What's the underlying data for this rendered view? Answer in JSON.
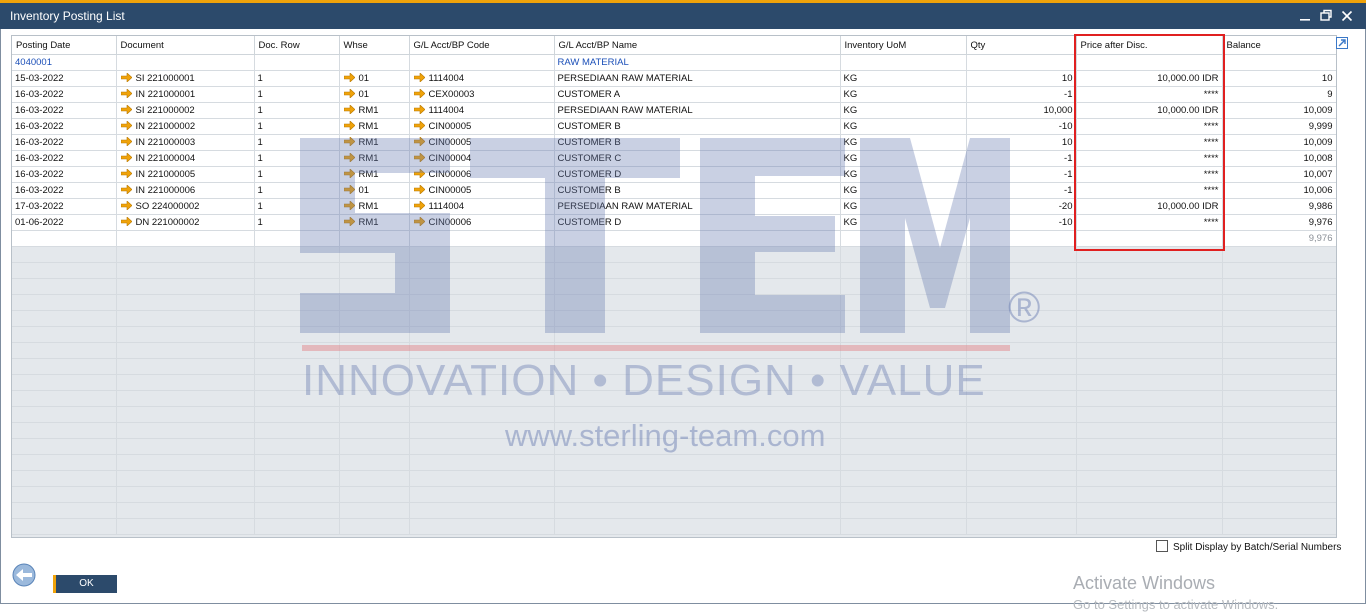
{
  "window": {
    "title": "Inventory Posting List"
  },
  "columns": [
    "Posting Date",
    "Document",
    "Doc. Row",
    "Whse",
    "G/L Acct/BP Code",
    "G/L Acct/BP Name",
    "Inventory UoM",
    "Qty",
    "Price after Disc.",
    "Balance"
  ],
  "group": {
    "code": "4040001",
    "name": "RAW MATERIAL"
  },
  "rows": [
    {
      "date": "15-03-2022",
      "document": "SI 221000001",
      "row": "1",
      "whse": "01",
      "code": "1114004",
      "name": "PERSEDIAAN RAW MATERIAL",
      "uom": "KG",
      "qty": "10",
      "price": "10,000.00 IDR",
      "balance": "10"
    },
    {
      "date": "16-03-2022",
      "document": "IN 221000001",
      "row": "1",
      "whse": "01",
      "code": "CEX00003",
      "name": "CUSTOMER A",
      "uom": "KG",
      "qty": "-1",
      "price": "****",
      "balance": "9"
    },
    {
      "date": "16-03-2022",
      "document": "SI 221000002",
      "row": "1",
      "whse": "RM1",
      "code": "1114004",
      "name": "PERSEDIAAN RAW MATERIAL",
      "uom": "KG",
      "qty": "10,000",
      "price": "10,000.00 IDR",
      "balance": "10,009"
    },
    {
      "date": "16-03-2022",
      "document": "IN 221000002",
      "row": "1",
      "whse": "RM1",
      "code": "CIN00005",
      "name": "CUSTOMER B",
      "uom": "KG",
      "qty": "-10",
      "price": "****",
      "balance": "9,999"
    },
    {
      "date": "16-03-2022",
      "document": "IN 221000003",
      "row": "1",
      "whse": "RM1",
      "code": "CIN00005",
      "name": "CUSTOMER B",
      "uom": "KG",
      "qty": "10",
      "price": "****",
      "balance": "10,009"
    },
    {
      "date": "16-03-2022",
      "document": "IN 221000004",
      "row": "1",
      "whse": "RM1",
      "code": "CIN00004",
      "name": "CUSTOMER C",
      "uom": "KG",
      "qty": "-1",
      "price": "****",
      "balance": "10,008"
    },
    {
      "date": "16-03-2022",
      "document": "IN 221000005",
      "row": "1",
      "whse": "RM1",
      "code": "CIN00006",
      "name": "CUSTOMER D",
      "uom": "KG",
      "qty": "-1",
      "price": "****",
      "balance": "10,007"
    },
    {
      "date": "16-03-2022",
      "document": "IN 221000006",
      "row": "1",
      "whse": "01",
      "code": "CIN00005",
      "name": "CUSTOMER B",
      "uom": "KG",
      "qty": "-1",
      "price": "****",
      "balance": "10,006"
    },
    {
      "date": "17-03-2022",
      "document": "SO 224000002",
      "row": "1",
      "whse": "RM1",
      "code": "1114004",
      "name": "PERSEDIAAN RAW MATERIAL",
      "uom": "KG",
      "qty": "-20",
      "price": "10,000.00 IDR",
      "balance": "9,986"
    },
    {
      "date": "01-06-2022",
      "document": "DN 221000002",
      "row": "1",
      "whse": "RM1",
      "code": "CIN00006",
      "name": "CUSTOMER D",
      "uom": "KG",
      "qty": "-10",
      "price": "****",
      "balance": "9,976"
    }
  ],
  "total": {
    "balance": "9,976"
  },
  "watermark": {
    "logo": "STEM",
    "registered": "®",
    "tagline": "INNOVATION • DESIGN • VALUE",
    "url": "www.sterling-team.com"
  },
  "footer": {
    "split_label": "Split Display by Batch/Serial Numbers",
    "ok_label": "OK"
  },
  "os_notice": {
    "title": "Activate Windows",
    "subtitle": "Go to Settings to activate Windows."
  },
  "colors": {
    "title_bar": "#2c4a6b",
    "accent": "#f0a30a",
    "highlight_border": "#e02020",
    "link": "#1b4fb8"
  }
}
